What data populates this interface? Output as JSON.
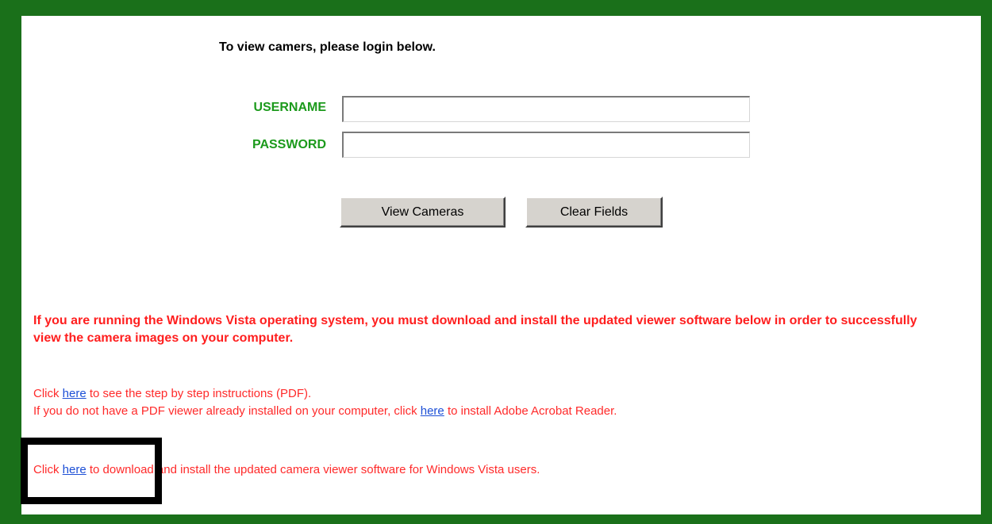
{
  "intro": "To view camers, please login below.",
  "form": {
    "username_label": "USERNAME",
    "password_label": "PASSWORD",
    "username_value": "",
    "password_value": "",
    "view_button": "View Cameras",
    "clear_button": "Clear Fields"
  },
  "warning": "If you are running the Windows Vista operating system, you must download and install the updated viewer software below in order to successfully view the camera images on your computer.",
  "instructions": {
    "line1_pre": "Click ",
    "line1_link": "here",
    "line1_post": " to see the step by step instructions (PDF).",
    "line2_pre": "If you do not have a PDF viewer already installed on your computer, click ",
    "line2_link": "here",
    "line2_post": " to install Adobe Acrobat Reader."
  },
  "download": {
    "pre": "Click ",
    "link": "here",
    "post": " to download and install the updated camera viewer software for Windows Vista users."
  },
  "colors": {
    "frame": "#1a701a",
    "label_green": "#1c9a1c",
    "warning_red": "#ff1e1e",
    "link_blue": "#1c4fd6"
  }
}
